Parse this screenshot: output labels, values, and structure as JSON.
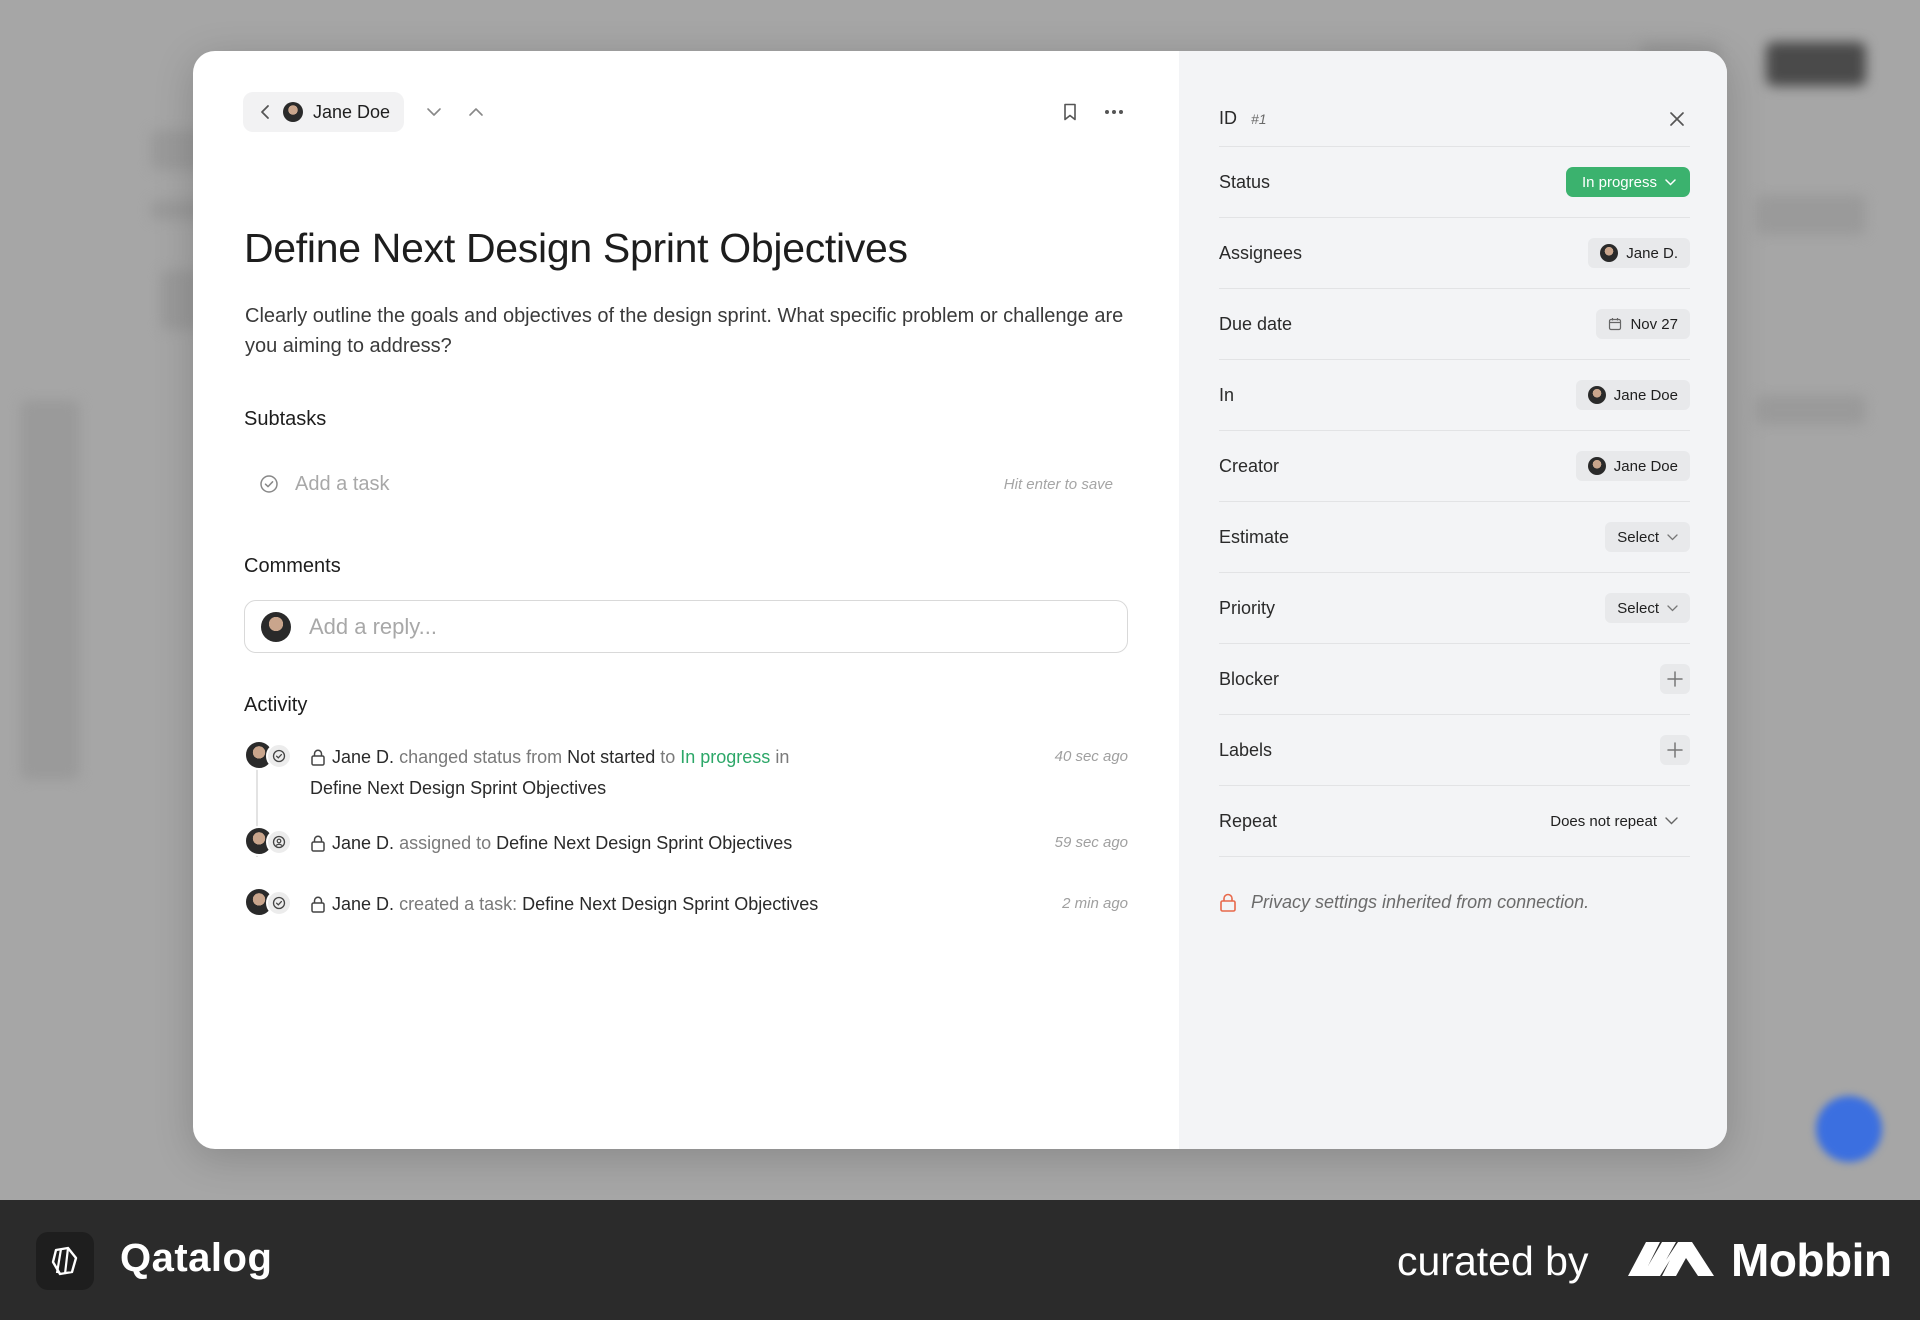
{
  "header": {
    "person_name": "Jane Doe"
  },
  "task": {
    "title": "Define Next Design Sprint Objectives",
    "description": "Clearly outline the goals and objectives of the design sprint. What specific problem or challenge are you aiming to address?"
  },
  "subtasks": {
    "heading": "Subtasks",
    "placeholder": "Add a task",
    "hint": "Hit enter to save"
  },
  "comments": {
    "heading": "Comments",
    "placeholder": "Add a reply..."
  },
  "activity": {
    "heading": "Activity",
    "items": [
      {
        "actor": "Jane D.",
        "text_1": "changed status from",
        "from": "Not started",
        "text_2": "to",
        "to": "In progress",
        "text_3": "in",
        "target": "Define Next Design Sprint Objectives",
        "time": "40 sec ago"
      },
      {
        "actor": "Jane D.",
        "text_1": "assigned to",
        "target": "Define Next Design Sprint Objectives",
        "time": "59 sec ago"
      },
      {
        "actor": "Jane D.",
        "text_1": "created a task:",
        "target": "Define Next Design Sprint Objectives",
        "time": "2 min ago"
      }
    ]
  },
  "sidebar": {
    "id_label": "ID",
    "id_value": "#1",
    "status_label": "Status",
    "status_value": "In progress",
    "status_color": "#3bb26e",
    "assignees_label": "Assignees",
    "assignees_value": "Jane D.",
    "due_label": "Due date",
    "due_value": "Nov 27",
    "in_label": "In",
    "in_value": "Jane Doe",
    "creator_label": "Creator",
    "creator_value": "Jane Doe",
    "estimate_label": "Estimate",
    "estimate_value": "Select",
    "priority_label": "Priority",
    "priority_value": "Select",
    "blocker_label": "Blocker",
    "labels_label": "Labels",
    "repeat_label": "Repeat",
    "repeat_value": "Does not repeat",
    "privacy_text": "Privacy settings inherited from connection.",
    "privacy_icon_color": "#e8684a"
  },
  "footer": {
    "app_name": "Qatalog",
    "curated_by": "curated by",
    "brand": "Mobbin"
  }
}
